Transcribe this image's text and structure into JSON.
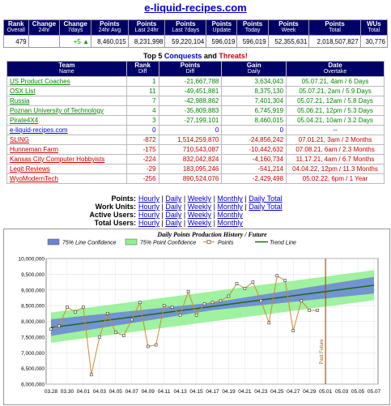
{
  "site_title": "e-liquid-recipes.com",
  "stats": {
    "headers": [
      {
        "main": "Rank",
        "sub": "Overall"
      },
      {
        "main": "Change",
        "sub": "24hr"
      },
      {
        "main": "Change",
        "sub": "7days"
      },
      {
        "main": "Points",
        "sub": "24hr Avg"
      },
      {
        "main": "Points",
        "sub": "Last 24hr"
      },
      {
        "main": "Points",
        "sub": "Last 7days"
      },
      {
        "main": "Points",
        "sub": "Update"
      },
      {
        "main": "Points",
        "sub": "Today"
      },
      {
        "main": "Points",
        "sub": "Week"
      },
      {
        "main": "Points",
        "sub": "Total"
      },
      {
        "main": "WUs",
        "sub": "Total"
      }
    ],
    "values": [
      "479",
      "",
      "+5",
      "8,460,015",
      "8,231,998",
      "59,220,104",
      "596,019",
      "596,019",
      "52,355,631",
      "2,018,507,827",
      "30,776"
    ]
  },
  "rivals_heading": {
    "prefix": "Top 5 ",
    "conquests": "Conquests",
    "and": " and ",
    "threats": "Threats!"
  },
  "rivals": {
    "headers": [
      {
        "main": "Team",
        "sub": "Name"
      },
      {
        "main": "Rank",
        "sub": "Diff"
      },
      {
        "main": "Points",
        "sub": "Diff"
      },
      {
        "main": "Gain",
        "sub": "Daily"
      },
      {
        "main": "Date",
        "sub": "Overtake"
      }
    ],
    "rows": [
      {
        "kind": "g",
        "name": "US Product Coaches",
        "rank": "1",
        "points": "-21,667,788",
        "gain": "3,634,043",
        "date": "05.07.21, 4am / 6 Days"
      },
      {
        "kind": "g",
        "name": "OSX List",
        "rank": "11",
        "points": "-49,451,881",
        "gain": "8,375,130",
        "date": "05.07.21, 2am / 5.9 Days"
      },
      {
        "kind": "g",
        "name": "Russia",
        "rank": "7",
        "points": "-42,988,862",
        "gain": "7,401,304",
        "date": "05.07.21, 12am / 5.8 Days"
      },
      {
        "kind": "g",
        "name": "Poznan University of Technology",
        "rank": "4",
        "points": "-35,809,883",
        "gain": "6,745,919",
        "date": "05.06.21, 12pm / 5.3 Days"
      },
      {
        "kind": "g",
        "name": "Pirate4X4",
        "rank": "3",
        "points": "-27,199,101",
        "gain": "8,460,015",
        "date": "05.04.21, 10am / 3.2 Days"
      },
      {
        "kind": "b",
        "name": "e-liquid-recipes.com",
        "rank": "0",
        "points": "0",
        "gain": "0",
        "date": "--"
      },
      {
        "kind": "r",
        "name": "SLING",
        "rank": "-872",
        "points": "1,514,259,870",
        "gain": "-24,856,242",
        "date": "07.01.21, 3am / 2 Months"
      },
      {
        "kind": "r",
        "name": "Hunneman Farm",
        "rank": "-175",
        "points": "710,543,087",
        "gain": "-10,442,632",
        "date": "07.08.21, 6am / 2.3 Months"
      },
      {
        "kind": "r",
        "name": "Kansas City Computer Hobbyists",
        "rank": "-224",
        "points": "832,042,824",
        "gain": "-4,160,734",
        "date": "11.17.21, 4am / 6.7 Months"
      },
      {
        "kind": "r",
        "name": "Legit Reviews",
        "rank": "-29",
        "points": "183,095,246",
        "gain": "-541,214",
        "date": "04.04.22, 12pm / 11.3 Months"
      },
      {
        "kind": "r",
        "name": "WyoModernTech",
        "rank": "-256",
        "points": "890,524,076",
        "gain": "-2,429,498",
        "date": "05.02.22, 6pm / 1 Year"
      }
    ]
  },
  "history_links": [
    {
      "label": "Points:",
      "links": [
        "Hourly",
        "Daily",
        "Weekly",
        "Monthly",
        "Daily Total"
      ]
    },
    {
      "label": "Work Units:",
      "links": [
        "Hourly",
        "Daily",
        "Weekly",
        "Monthly",
        "Daily Total"
      ]
    },
    {
      "label": "Active Users:",
      "links": [
        "Hourly",
        "Daily",
        "Weekly",
        "Monthly"
      ]
    },
    {
      "label": "Total Users:",
      "links": [
        "Hourly",
        "Daily",
        "Weekly",
        "Monthly"
      ]
    }
  ],
  "chart_data": {
    "type": "line",
    "title": "Daily Points Production History / Future",
    "legend": [
      "75% Line Confidence",
      "75% Point Confidence",
      "Points",
      "Trend Line"
    ],
    "legend_position": "top",
    "colors": {
      "line_conf": "#6b84d6",
      "point_conf": "#8ef08e",
      "points": "#d08a30",
      "trend": "#1a6a1a",
      "future": "#a05a10"
    },
    "ylim": [
      6000000,
      10000000
    ],
    "yticks": [
      "6,000,000",
      "6,500,000",
      "7,000,000",
      "7,500,000",
      "8,000,000",
      "8,500,000",
      "9,000,000",
      "9,500,000",
      "10,000,000"
    ],
    "xticks": [
      "03.28",
      "03.30",
      "04.01",
      "04.03",
      "04.05",
      "04.07",
      "04.09",
      "04.11",
      "04.13",
      "04.15",
      "04.17",
      "04.19",
      "04.21",
      "04.23",
      "04.25",
      "04.27",
      "04.29",
      "05.01",
      "05.03",
      "05.05",
      "05.07"
    ],
    "grid": true,
    "future_label": "Past Future",
    "future_x": 34,
    "x": [
      0,
      1,
      2,
      3,
      4,
      5,
      6,
      7,
      8,
      9,
      10,
      11,
      12,
      13,
      14,
      15,
      16,
      17,
      18,
      19,
      20,
      21,
      22,
      23,
      24,
      25,
      26,
      27,
      28,
      29,
      30,
      31,
      32,
      33
    ],
    "points": [
      7750000,
      7850000,
      8450000,
      8300000,
      8450000,
      6300000,
      7500000,
      8250000,
      7650000,
      7550000,
      8050000,
      8600000,
      7200000,
      7250000,
      8500000,
      8450000,
      8200000,
      8950000,
      8200000,
      8550000,
      8600000,
      8650000,
      8800000,
      9200000,
      9050000,
      9250000,
      8650000,
      7950000,
      9450000,
      9300000,
      7700000,
      8650000,
      8350000,
      8350000
    ],
    "trend": {
      "start": 7800000,
      "end": 9150000,
      "x_end": 40
    },
    "line_conf": {
      "half_start": 120000,
      "half_end": 280000
    },
    "point_conf": {
      "half": 480000
    }
  }
}
